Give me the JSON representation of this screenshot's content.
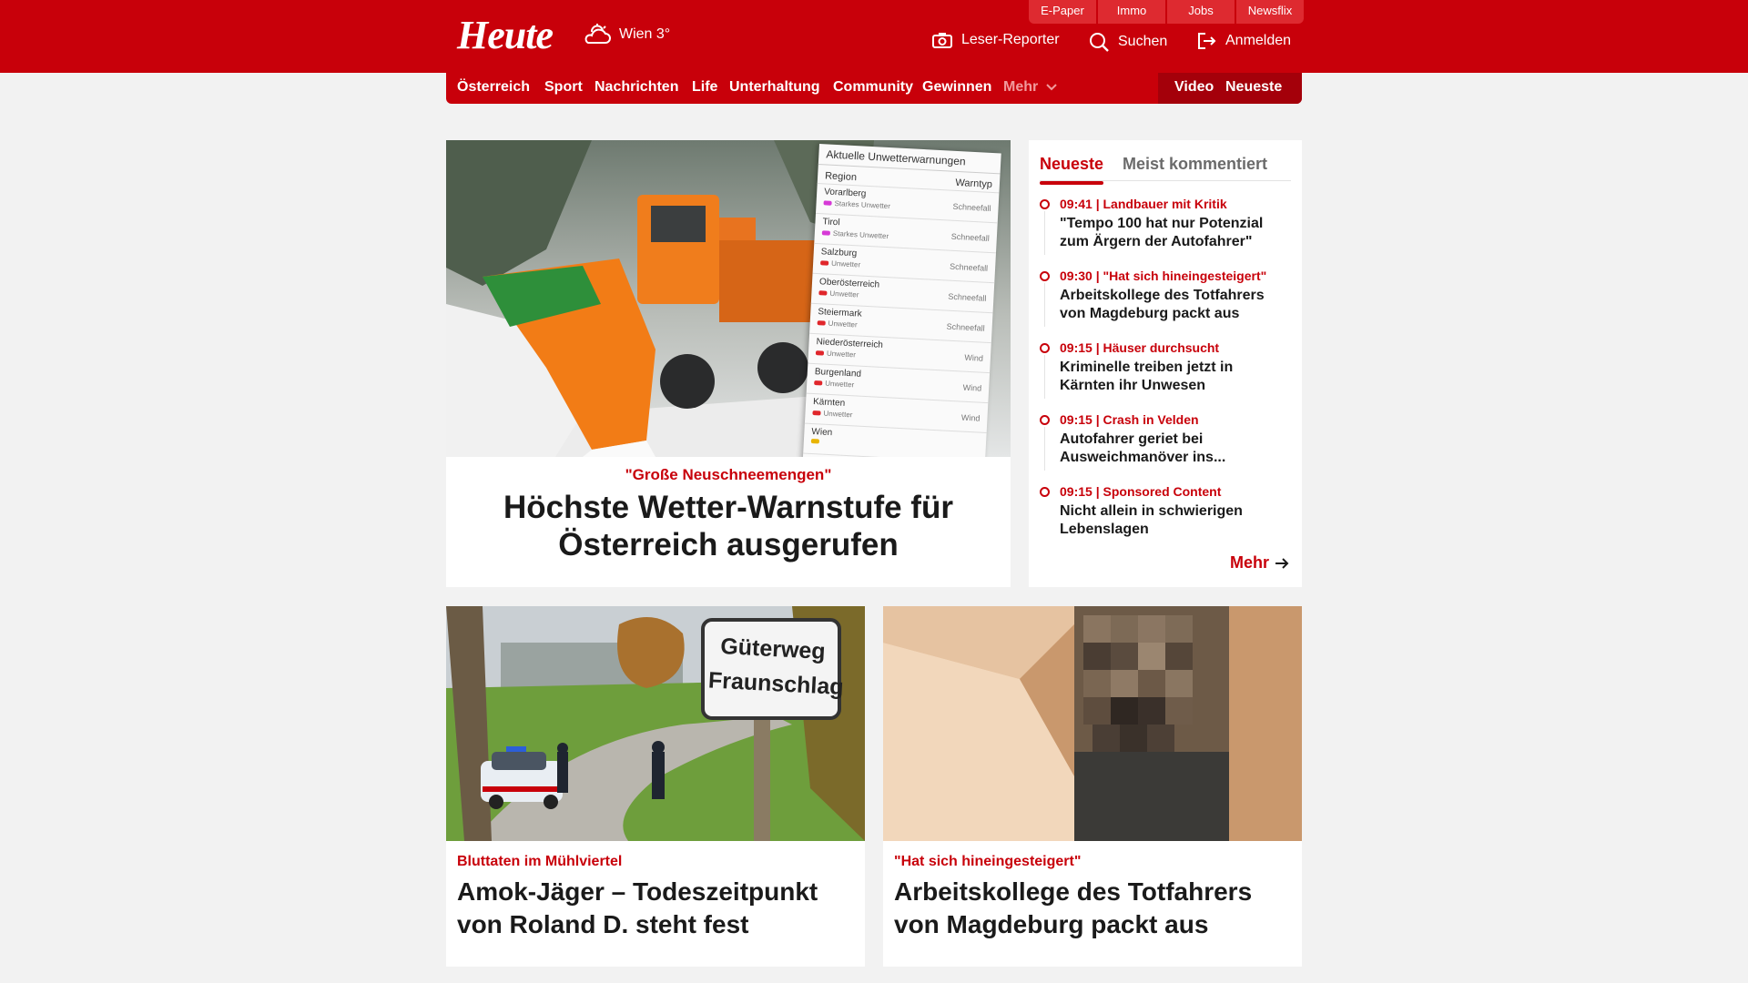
{
  "brand": {
    "logo": "Heute",
    "weather": "Wien 3°"
  },
  "services": [
    "E-Paper",
    "Immo",
    "Jobs",
    "Newsflix"
  ],
  "tools": {
    "reporter": "Leser-Reporter",
    "search": "Suchen",
    "login": "Anmelden"
  },
  "nav": {
    "items": [
      "Österreich",
      "Sport",
      "Nachrichten",
      "Life",
      "Unterhaltung",
      "Community",
      "Gewinnen"
    ],
    "more": "Mehr",
    "video": "Video",
    "neueste": "Neueste"
  },
  "hero": {
    "kicker": "\"Große Neuschneemengen\"",
    "title": "Höchste Wetter-Warnstufe für Österreich ausgerufen",
    "image_panel": {
      "title": "Aktuelle Unwetterwarnungen",
      "col_region": "Region",
      "col_type": "Warntyp",
      "rows": [
        {
          "region": "Vorarlberg",
          "level": "Starkes Unwetter",
          "type": "Schneefall",
          "color": "#d63ad6"
        },
        {
          "region": "Tirol",
          "level": "Starkes Unwetter",
          "type": "Schneefall",
          "color": "#d63ad6"
        },
        {
          "region": "Salzburg",
          "level": "Unwetter",
          "type": "Schneefall",
          "color": "#e0262b"
        },
        {
          "region": "Oberösterreich",
          "level": "Unwetter",
          "type": "Schneefall",
          "color": "#e0262b"
        },
        {
          "region": "Steiermark",
          "level": "Unwetter",
          "type": "Schneefall",
          "color": "#e0262b"
        },
        {
          "region": "Niederösterreich",
          "level": "Unwetter",
          "type": "Wind",
          "color": "#e0262b"
        },
        {
          "region": "Burgenland",
          "level": "Unwetter",
          "type": "Wind",
          "color": "#e0262b"
        },
        {
          "region": "Kärnten",
          "level": "Unwetter",
          "type": "Wind",
          "color": "#e0262b"
        },
        {
          "region": "Wien",
          "level": "",
          "type": "",
          "color": "#e8b400"
        }
      ]
    }
  },
  "latest": {
    "tab_active": "Neueste",
    "tab_inactive": "Meist kommentiert",
    "items": [
      {
        "meta": "09:41 | Landbauer mit Kritik",
        "headline": "\"Tempo 100 hat nur Potenzial zum Ärgern der Autofahrer\""
      },
      {
        "meta": "09:30 | \"Hat sich hineingesteigert\"",
        "headline": "Arbeitskollege des Totfahrers von Magdeburg packt aus"
      },
      {
        "meta": "09:15 | Häuser durchsucht",
        "headline": "Kriminelle treiben jetzt in Kärnten ihr Unwesen"
      },
      {
        "meta": "09:15 | Crash in Velden",
        "headline": "Autofahrer geriet bei Ausweichmanöver ins..."
      },
      {
        "meta": "09:15 | Sponsored Content",
        "headline": "Nicht allein in schwierigen Lebenslagen"
      }
    ],
    "more": "Mehr"
  },
  "cards": [
    {
      "kicker": "Bluttaten im Mühlviertel",
      "title": "Amok-Jäger – Todeszeitpunkt von Roland D. steht fest",
      "sign_line1": "Güterweg",
      "sign_line2": "Fraunschlag"
    },
    {
      "kicker": "\"Hat sich hineingesteigert\"",
      "title": "Arbeitskollege des Totfahrers von Magdeburg packt aus"
    }
  ],
  "colors": {
    "brand": "#c8000a",
    "background": "#f2f2f2"
  }
}
